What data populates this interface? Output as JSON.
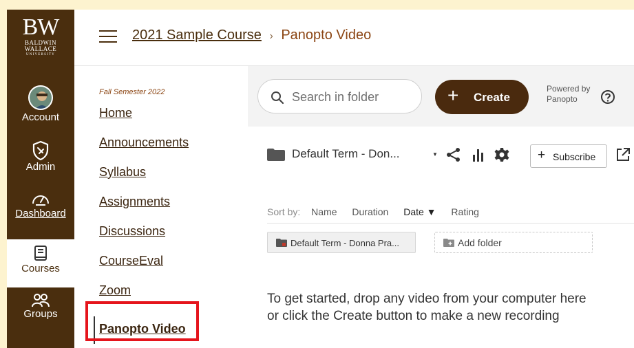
{
  "logo": {
    "initials": "BW",
    "line1": "BALDWIN",
    "line2": "WALLACE",
    "line3": "UNIVERSITY"
  },
  "global_nav": [
    {
      "label": "Account",
      "icon": "avatar"
    },
    {
      "label": "Admin",
      "icon": "shield-icon"
    },
    {
      "label": "Dashboard",
      "icon": "dashboard-icon"
    },
    {
      "label": "Courses",
      "icon": "book-icon"
    },
    {
      "label": "Groups",
      "icon": "groups-icon"
    }
  ],
  "breadcrumb": {
    "course": "2021 Sample Course",
    "separator": "›",
    "current": "Panopto Video"
  },
  "course_nav": {
    "term": "Fall Semester 2022",
    "items": [
      "Home",
      "Announcements",
      "Syllabus",
      "Assignments",
      "Discussions",
      "CourseEval",
      "Zoom",
      "Panopto Video"
    ]
  },
  "panopto": {
    "search_placeholder": "Search in folder",
    "create_label": "Create",
    "powered_line1": "Powered by",
    "powered_line2": "Panopto",
    "folder_name": "Default Term - Don...",
    "subscribe_label": "Subscribe",
    "sort_label": "Sort by:",
    "sort_options": [
      "Name",
      "Duration",
      "Date ▼",
      "Rating"
    ],
    "folder_chip": "Default Term - Donna Pra...",
    "add_folder": "Add folder",
    "empty_line1": "To get started, drop any video from your computer here",
    "empty_line2": "or click the Create button to make a new recording"
  },
  "colors": {
    "brand": "#4a2e0e",
    "highlight": "#e5141c",
    "page_bg": "#fdf3cf"
  }
}
